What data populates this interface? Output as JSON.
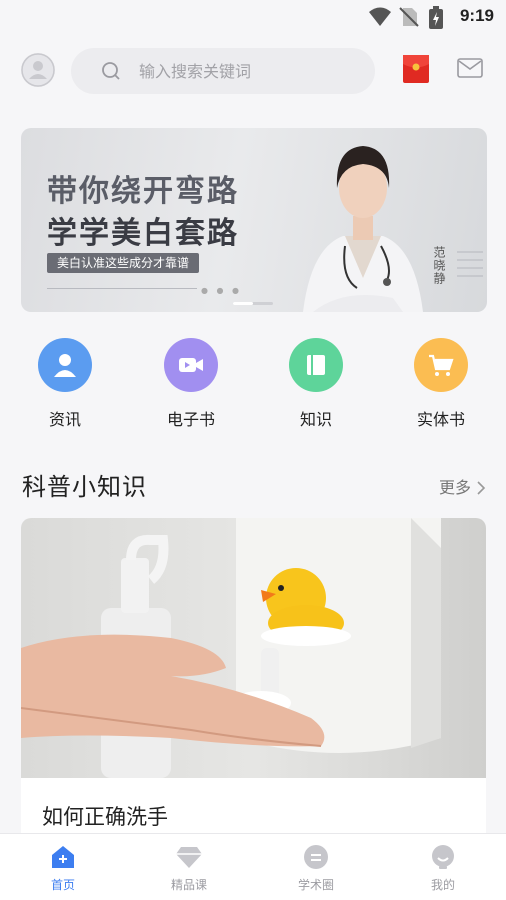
{
  "status_bar": {
    "time": "9:19"
  },
  "header": {
    "search_placeholder": "输入搜索关键词",
    "icons": [
      "avatar-icon",
      "search-icon",
      "red-packet-icon",
      "mail-icon"
    ]
  },
  "banner": {
    "line1": "带你绕开弯路",
    "line2": "学学美白套路",
    "tag": "美白认准这些成分才靠谱",
    "name": "范晓静",
    "slide_index": 1,
    "slide_count": 2
  },
  "categories": [
    {
      "label": "资讯",
      "icon": "news-person-icon",
      "color": "#5b9cf0"
    },
    {
      "label": "电子书",
      "icon": "video-camera-icon",
      "color": "#a18ff0"
    },
    {
      "label": "知识",
      "icon": "book-icon",
      "color": "#5ed49a"
    },
    {
      "label": "实体书",
      "icon": "cart-icon",
      "color": "#fbbd52"
    }
  ],
  "section": {
    "title": "科普小知识",
    "more": "更多"
  },
  "article": {
    "title": "如何正确洗手"
  },
  "tabs": [
    {
      "label": "首页",
      "icon": "home-icon",
      "active": true
    },
    {
      "label": "精品课",
      "icon": "diamond-icon",
      "active": false
    },
    {
      "label": "学术圈",
      "icon": "chat-icon",
      "active": false
    },
    {
      "label": "我的",
      "icon": "profile-icon",
      "active": false
    }
  ],
  "colors": {
    "accent": "#3d7ef0",
    "inactive": "#c6c6cb"
  }
}
